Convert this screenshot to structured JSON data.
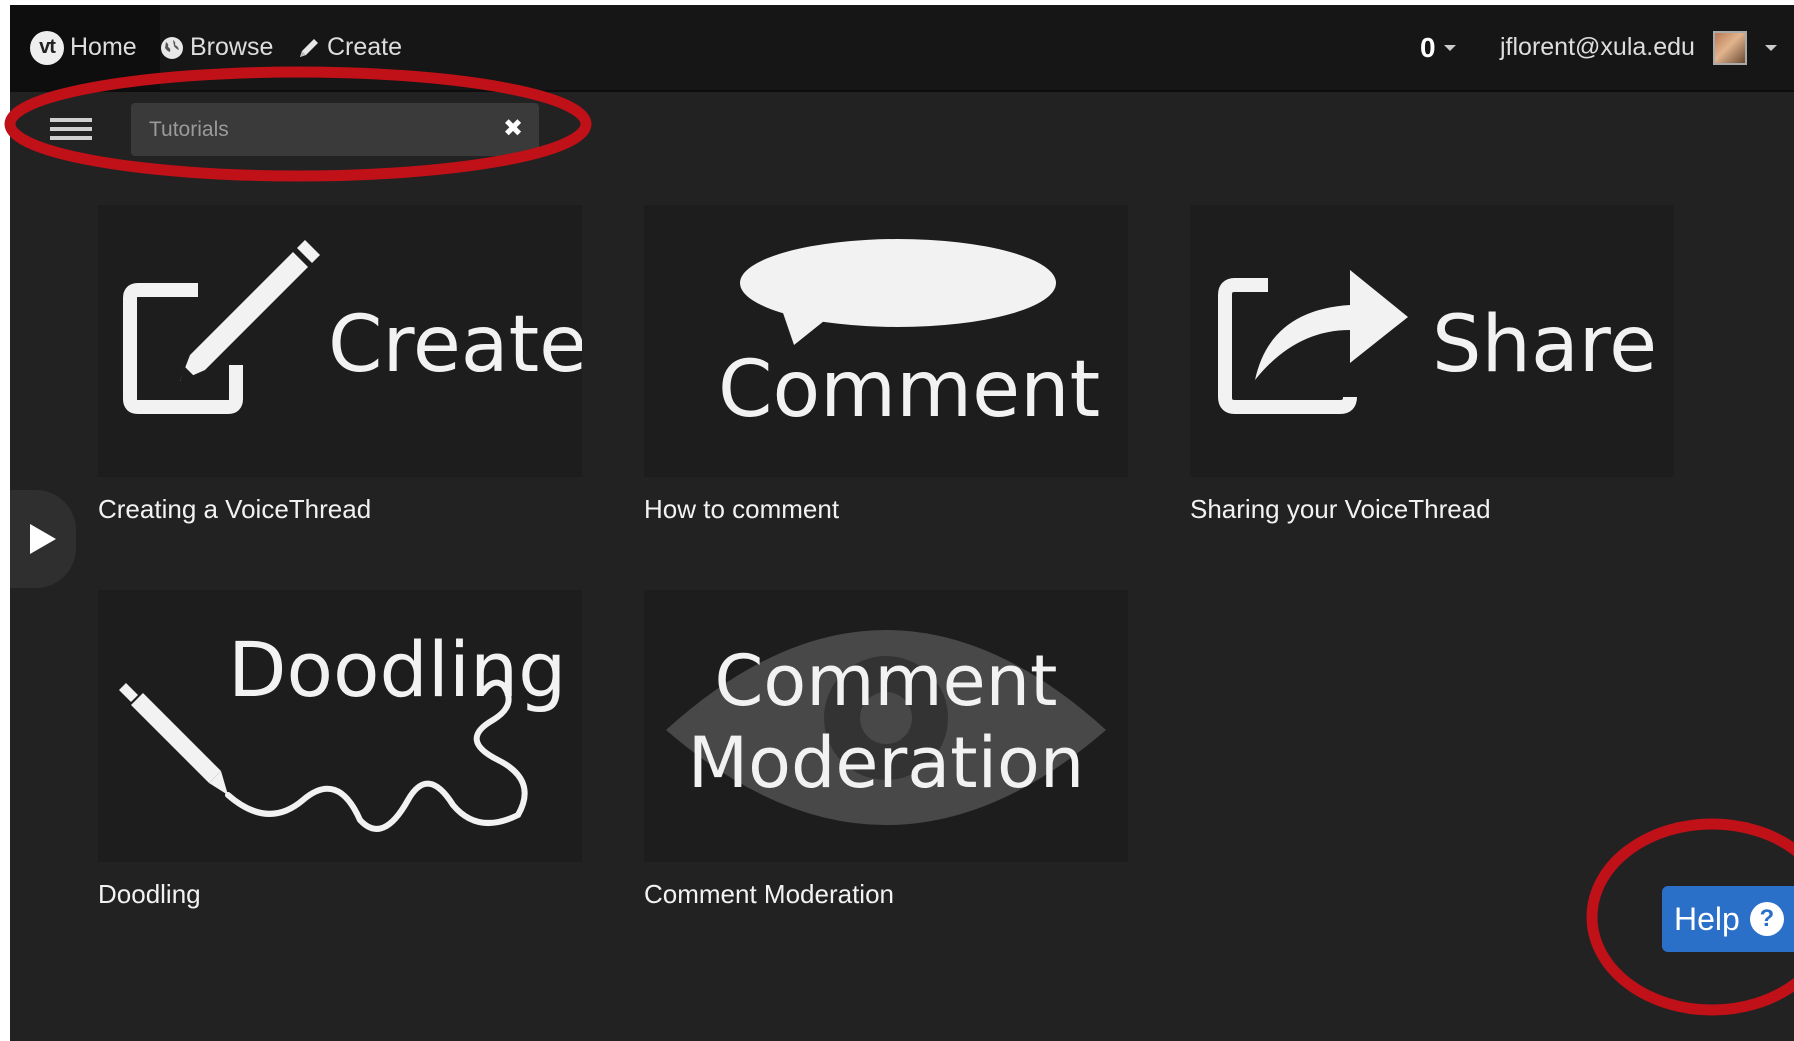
{
  "nav": {
    "home_logo": "vt",
    "home_label": "Home",
    "browse_label": "Browse",
    "create_label": "Create",
    "notification_count": "0",
    "user_email": "jflorent@xula.edu"
  },
  "filter": {
    "value": "Tutorials",
    "clear_glyph": "✖"
  },
  "cards": [
    {
      "thumb_text": "Create",
      "title": "Creating a VoiceThread",
      "icon": "edit-pencil-icon"
    },
    {
      "thumb_text": "Comment",
      "title": "How to comment",
      "icon": "speech-bubble-icon"
    },
    {
      "thumb_text": "Share",
      "title": "Sharing your VoiceThread",
      "icon": "share-arrow-icon"
    },
    {
      "thumb_text": "Doodling",
      "title": "Doodling",
      "icon": "pencil-squiggle-icon"
    },
    {
      "thumb_text_line1": "Comment",
      "thumb_text_line2": "Moderation",
      "title": "Comment Moderation",
      "icon": "eye-icon"
    }
  ],
  "help": {
    "label": "Help",
    "glyph": "?"
  },
  "colors": {
    "page_bg": "#222222",
    "navbar_bg": "#161616",
    "help_blue": "#2a6fc8",
    "annotation_red": "#c01018"
  }
}
